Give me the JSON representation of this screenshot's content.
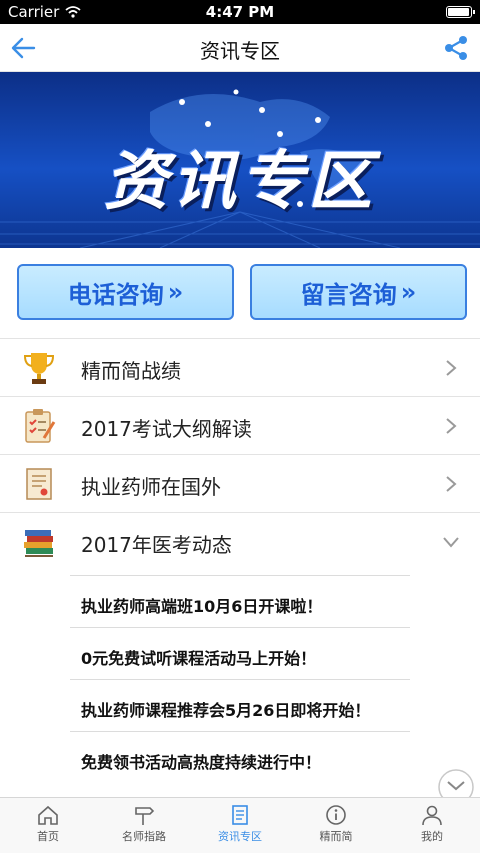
{
  "status_bar": {
    "carrier": "Carrier",
    "time": "4:47 PM",
    "battery_level": 1.0
  },
  "nav": {
    "title": "资讯专区",
    "back_icon": "back-arrow-icon",
    "share_icon": "share-icon"
  },
  "banner": {
    "title": "资讯专区"
  },
  "consult": {
    "phone_label": "电话咨询",
    "message_label": "留言咨询",
    "arrows": "»"
  },
  "list": {
    "items": [
      {
        "label": "精而简战绩",
        "icon": "trophy-icon",
        "expanded": false
      },
      {
        "label": "2017考试大纲解读",
        "icon": "checklist-icon",
        "expanded": false
      },
      {
        "label": "执业药师在国外",
        "icon": "certificate-icon",
        "expanded": false
      },
      {
        "label": "2017年医考动态",
        "icon": "books-icon",
        "expanded": true
      }
    ],
    "sub_items": [
      "执业药师高端班10月6日开课啦！",
      "0元免费试听课程活动马上开始！",
      "执业药师课程推荐会5月26日即将开始！",
      "免费领书活动高热度持续进行中！"
    ]
  },
  "tabs": [
    {
      "label": "首页",
      "icon": "home-icon",
      "active": false
    },
    {
      "label": "名师指路",
      "icon": "signpost-icon",
      "active": false
    },
    {
      "label": "资讯专区",
      "icon": "document-icon",
      "active": true
    },
    {
      "label": "精而简",
      "icon": "info-icon",
      "active": false
    },
    {
      "label": "我的",
      "icon": "user-icon",
      "active": false
    }
  ],
  "colors": {
    "accent": "#3a8ee6",
    "banner": "#1650c4",
    "button_text": "#1d5fd6"
  }
}
